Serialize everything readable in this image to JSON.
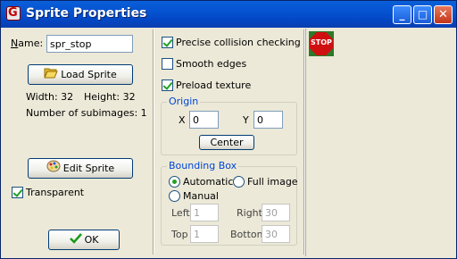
{
  "window": {
    "title": "Sprite Properties",
    "app_icon": "game-maker-icon"
  },
  "titlebar_buttons": {
    "minimize": "_",
    "maximize": "□",
    "close": "✕"
  },
  "name": {
    "label": "Name:",
    "value": "spr_stop"
  },
  "load_sprite": {
    "label": "Load Sprite",
    "icon": "folder-open-icon"
  },
  "info": {
    "width": "Width: 32",
    "height": "Height: 32",
    "subimages": "Number of subimages: 1"
  },
  "edit_sprite": {
    "label": "Edit Sprite",
    "icon": "palette-icon"
  },
  "transparent": {
    "label": "Transparent",
    "checked": true
  },
  "ok": {
    "label": "OK",
    "icon": "checkmark-icon"
  },
  "options": {
    "precise": {
      "label": "Precise collision checking",
      "checked": true
    },
    "smooth": {
      "label": "Smooth edges",
      "checked": false
    },
    "preload": {
      "label": "Preload texture",
      "checked": true
    }
  },
  "origin": {
    "title": "Origin",
    "x_label": "X",
    "x_value": "0",
    "y_label": "Y",
    "y_value": "0",
    "center_label": "Center"
  },
  "bbox": {
    "title": "Bounding Box",
    "automatic": {
      "label": "Automatic",
      "selected": true
    },
    "full": {
      "label": "Full image",
      "selected": false
    },
    "manual": {
      "label": "Manual",
      "selected": false
    },
    "left_label": "Left",
    "left_value": "1",
    "right_label": "Right",
    "right_value": "30",
    "top_label": "Top",
    "top_value": "1",
    "bottom_label": "Bottom",
    "bottom_value": "30"
  },
  "preview": {
    "sprite_text": "STOP"
  }
}
